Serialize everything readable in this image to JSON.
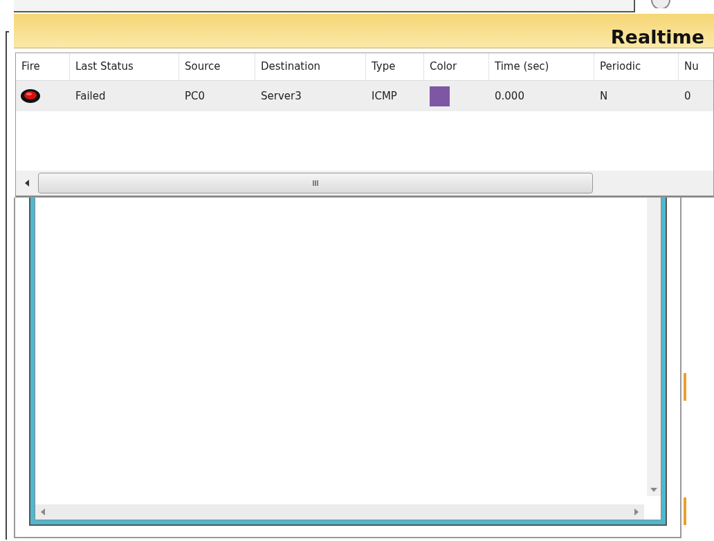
{
  "mode_bar": {
    "title": "Realtime"
  },
  "pdu_table": {
    "columns": [
      "Fire",
      "Last Status",
      "Source",
      "Destination",
      "Type",
      "Color",
      "Time (sec)",
      "Periodic",
      "Nu"
    ],
    "rows": [
      {
        "last_status": "Failed",
        "source": "PC0",
        "destination": "Server3",
        "type": "ICMP",
        "color": "#7e57a4",
        "time": "0.000",
        "periodic": "N",
        "num": "0"
      }
    ]
  }
}
